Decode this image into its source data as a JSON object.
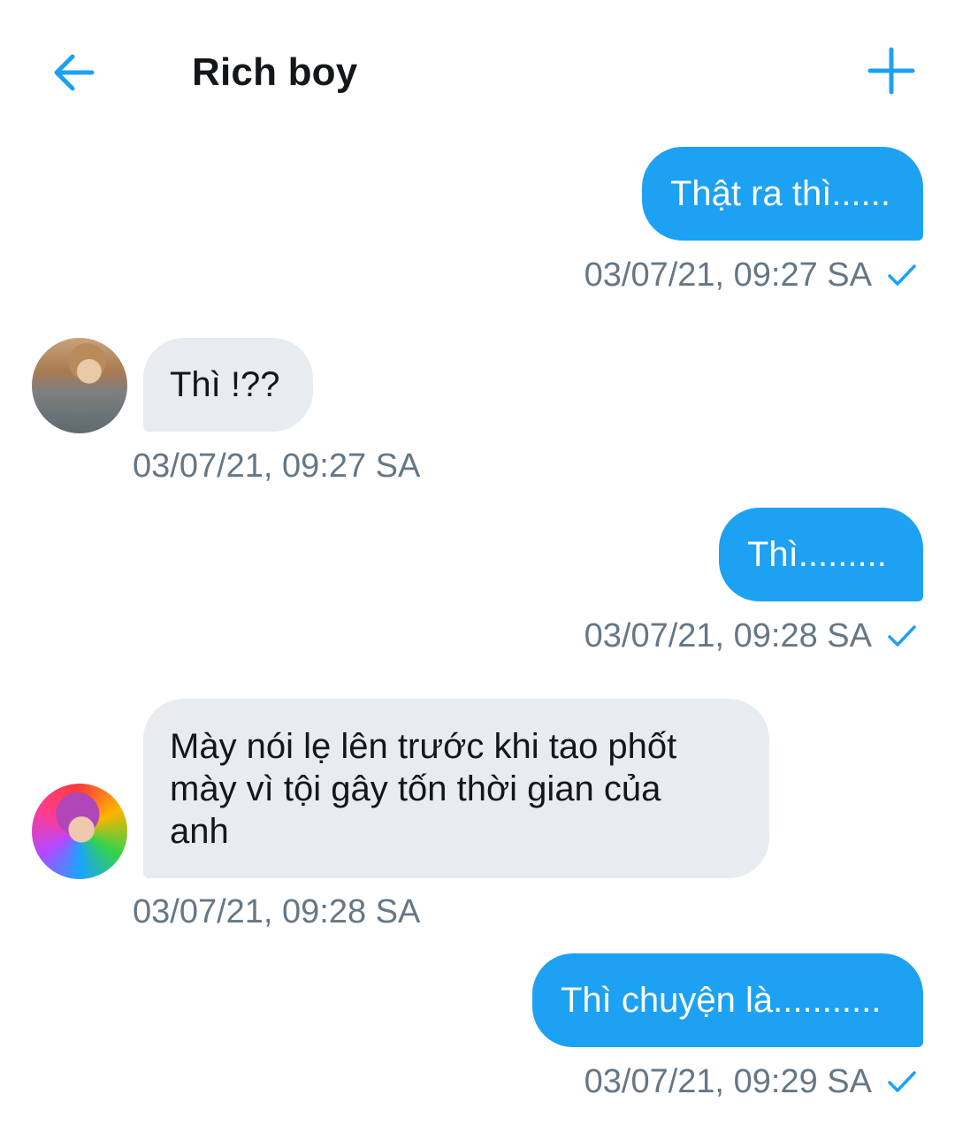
{
  "header": {
    "title": "Rich boy"
  },
  "colors": {
    "accent": "#1da1f2",
    "incoming_bubble": "#e6ecf0",
    "meta_text": "#657786"
  },
  "icons": {
    "back": "arrow-left-icon",
    "add": "plus-icon",
    "sent": "checkmark-icon"
  },
  "messages": [
    {
      "direction": "out",
      "text": "Thật ra thì......",
      "time": "03/07/21, 09:27 SA",
      "status": "sent"
    },
    {
      "direction": "in",
      "text": "Thì !??",
      "time": "03/07/21, 09:27 SA"
    },
    {
      "direction": "out",
      "text": "Thì.........",
      "time": "03/07/21, 09:28 SA",
      "status": "sent"
    },
    {
      "direction": "in",
      "lines": [
        "Mày nói lẹ lên trước khi tao phốt",
        "mày vì tội gây tốn thời gian của",
        "anh"
      ],
      "time": "03/07/21, 09:28 SA"
    },
    {
      "direction": "out",
      "text": "Thì chuyện là...........",
      "time": "03/07/21, 09:29 SA",
      "status": "sent"
    }
  ]
}
